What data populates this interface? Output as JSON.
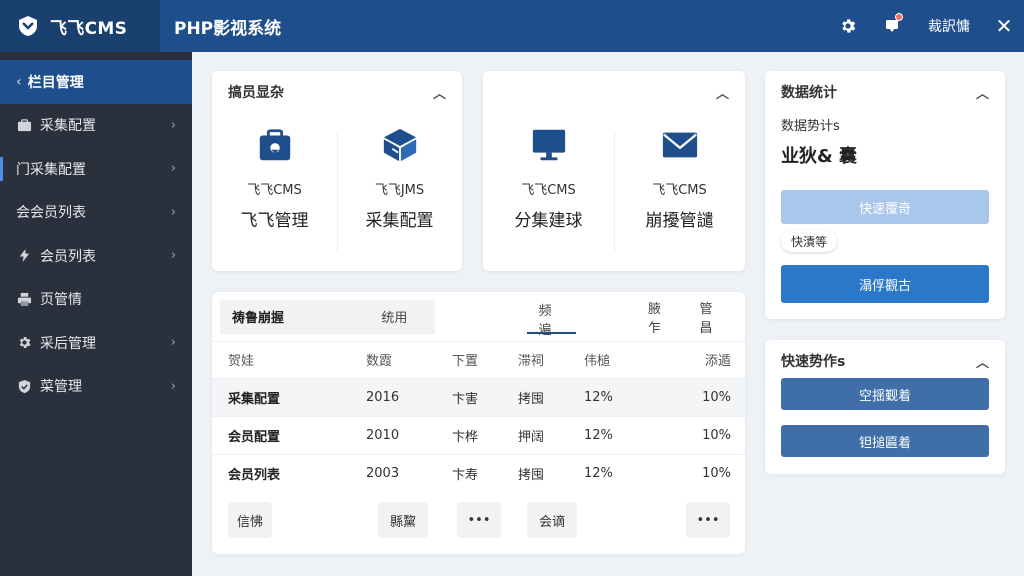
{
  "header": {
    "brand": "飞飞CMS",
    "system_title": "PHP影视系统",
    "user_name": "裁訳慵",
    "close_symbol": "✕",
    "accent_color": "#1f4e8c"
  },
  "sidebar": {
    "items": [
      {
        "label": "栏目管理",
        "icon": "back-arrow"
      },
      {
        "label": "采集配置",
        "icon": "briefcase-icon"
      },
      {
        "label": "门采集配置",
        "icon": "none"
      },
      {
        "label": "会会员列表",
        "icon": "none"
      },
      {
        "label": "会员列表",
        "icon": "bolt-icon"
      },
      {
        "label": "页管情",
        "icon": "printer-icon"
      },
      {
        "label": "采后管理",
        "icon": "gear-icon"
      },
      {
        "label": "菜管理",
        "icon": "shield-icon"
      }
    ]
  },
  "card_shortcuts_1": {
    "title": "搞员显杂",
    "tiles": [
      {
        "small": "飞飞CMS",
        "big": "飞飞管理",
        "icon": "lock-bag-icon"
      },
      {
        "small": "飞飞JMS",
        "big": "采集配置",
        "icon": "box-icon"
      }
    ]
  },
  "card_shortcuts_2": {
    "tiles": [
      {
        "small": "飞飞CMS",
        "big": "分集建球",
        "icon": "monitor-icon"
      },
      {
        "small": "飞飞CMS",
        "big": "崩擾管譴",
        "icon": "mail-icon"
      }
    ]
  },
  "table": {
    "tabs": [
      "祷鲁崩握",
      "统用",
      "频遍",
      "腋乍",
      "管昌"
    ],
    "headers": [
      "贺娃",
      "数霞",
      "下置",
      "滞祠",
      "伟槌",
      "添遁"
    ],
    "rows": [
      [
        "采集配置",
        "2016",
        "卞害",
        "拷囤",
        "12%",
        "10%"
      ],
      [
        "会员配置",
        "2010",
        "卞桦",
        "押阔",
        "12%",
        "10%"
      ],
      [
        "会员列表",
        "2003",
        "卞寿",
        "拷囤",
        "12%",
        "10%"
      ]
    ],
    "buttons": [
      "信怫",
      "縣黧",
      "•••",
      "会谪",
      "•••"
    ]
  },
  "stats": {
    "title": "数据统计",
    "subtitle": "数据势计s",
    "value": "业狄& 囊",
    "btn_light": "快速覆奇",
    "pill": "快漬等",
    "btn_primary": "溻俘觀古"
  },
  "quick": {
    "title": "快速势作s",
    "btn1": "空揺觐着",
    "btn2": "钽搥匾着"
  }
}
